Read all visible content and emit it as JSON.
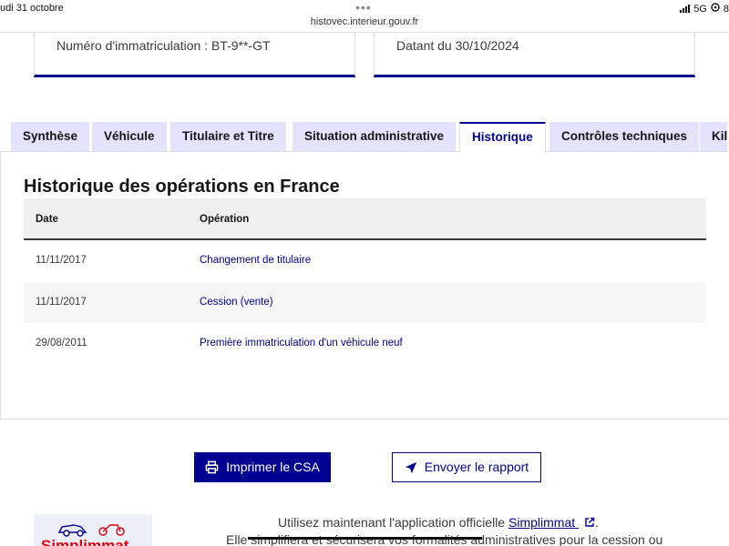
{
  "status_bar": {
    "time_date": "udi 31 octobre",
    "url": "histovec.interieur.gouv.fr",
    "network": "5G",
    "battery": "8"
  },
  "cards": {
    "plate_label": "Numéro d'immatriculation : BT-9**-GT",
    "date_label": "Datant du 30/10/2024"
  },
  "tabs": [
    {
      "label": "Synthèse"
    },
    {
      "label": "Véhicule"
    },
    {
      "label": "Titulaire et Titre"
    },
    {
      "label": "Situation administrative"
    },
    {
      "label": "Historique"
    },
    {
      "label": "Contrôles techniques"
    },
    {
      "label": "Kil"
    }
  ],
  "active_tab": "Historique",
  "history": {
    "title": "Historique des opérations en France",
    "columns": [
      "Date",
      "Opération"
    ],
    "rows": [
      {
        "date": "11/11/2017",
        "operation": "Changement de titulaire"
      },
      {
        "date": "11/11/2017",
        "operation": "Cession (vente)"
      },
      {
        "date": "29/08/2011",
        "operation": "Première immatriculation d'un véhicule neuf"
      }
    ]
  },
  "actions": {
    "print_label": "Imprimer le CSA",
    "send_label": "Envoyer le rapport"
  },
  "footer": {
    "line1_prefix": "Utilisez maintenant l'application officielle ",
    "link_label": "Simplimmat",
    "line1_suffix": ".",
    "line2": "Elle simplifiera et sécurisera vos formalités administratives pour la cession ou",
    "logo_text": "Simplimmat"
  },
  "icons": {
    "printer": "printer-icon",
    "send": "send-icon",
    "external_link": "external-link-icon",
    "wifi": "wifi-icon"
  },
  "colors": {
    "brand_blue": "#000091",
    "tab_bg": "#e3e3fd",
    "logo_red": "#e1000f"
  }
}
